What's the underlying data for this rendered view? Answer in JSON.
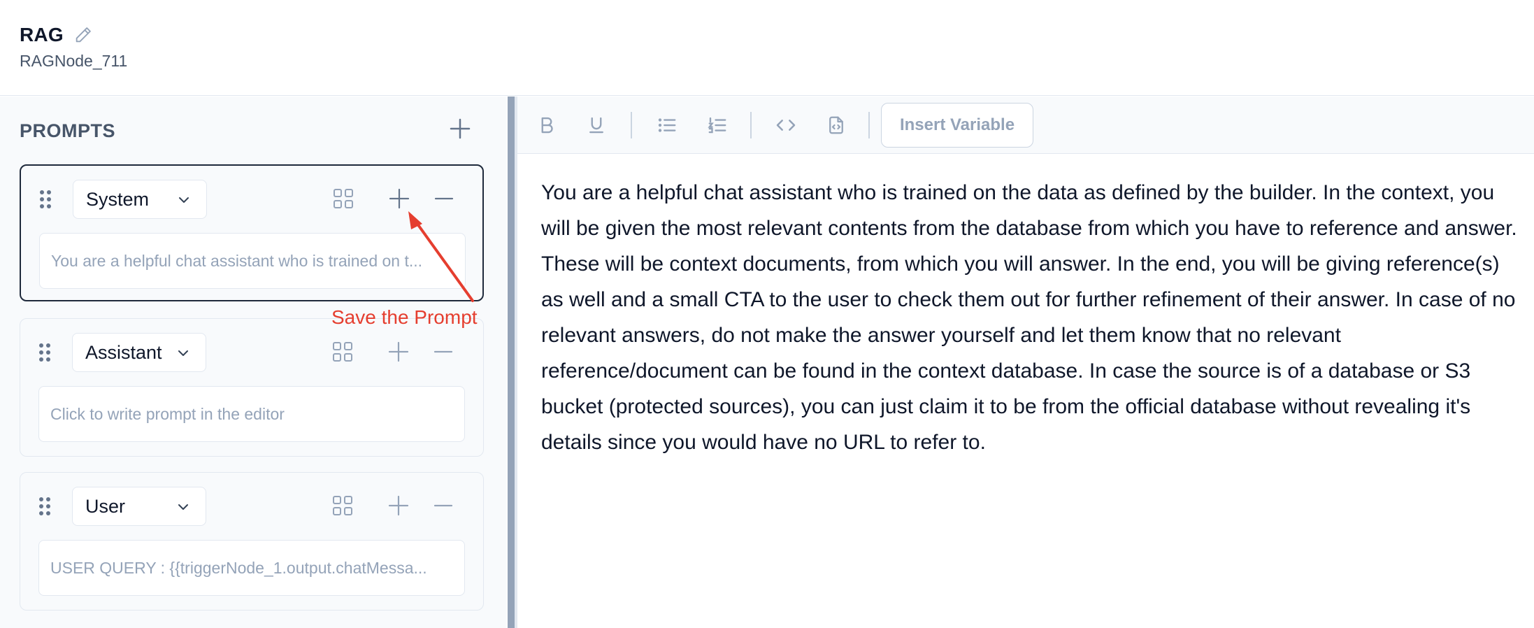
{
  "header": {
    "title": "RAG",
    "node_id": "RAGNode_711"
  },
  "prompts_panel": {
    "label": "PROMPTS",
    "cards": [
      {
        "role": "System",
        "content": "You are a helpful chat assistant who is trained on t...",
        "active": true
      },
      {
        "role": "Assistant",
        "placeholder": "Click to write prompt in the editor",
        "active": false
      },
      {
        "role": "User",
        "content": "USER QUERY : {{triggerNode_1.output.chatMessa...",
        "active": false
      }
    ]
  },
  "annotation": {
    "text": "Save the Prompt",
    "color": "#e53e2f"
  },
  "editor": {
    "toolbar": {
      "insert_variable_label": "Insert Variable",
      "icons": [
        "bold-icon",
        "underline-icon",
        "bullet-list-icon",
        "numbered-list-icon",
        "code-icon",
        "code-file-icon"
      ]
    },
    "text": "You are a helpful chat assistant who is trained on the data as defined by the builder. In the context, you will be given the most relevant contents from the database from which you have to reference and answer. These will be context documents, from which you will answer. In the end, you will be giving reference(s) as well and a small CTA to the user to check them out for further refinement of their answer. In case of no relevant answers, do not make the answer yourself and let them know that no relevant reference/document can be found in the context database. In case the source is of a database or S3 bucket (protected sources), you can just claim it to be from the official database without revealing it's details since you would have no URL to refer to."
  },
  "colors": {
    "active_border": "#1e293b",
    "muted_text": "#94a3b8",
    "annotation": "#e53e2f"
  }
}
